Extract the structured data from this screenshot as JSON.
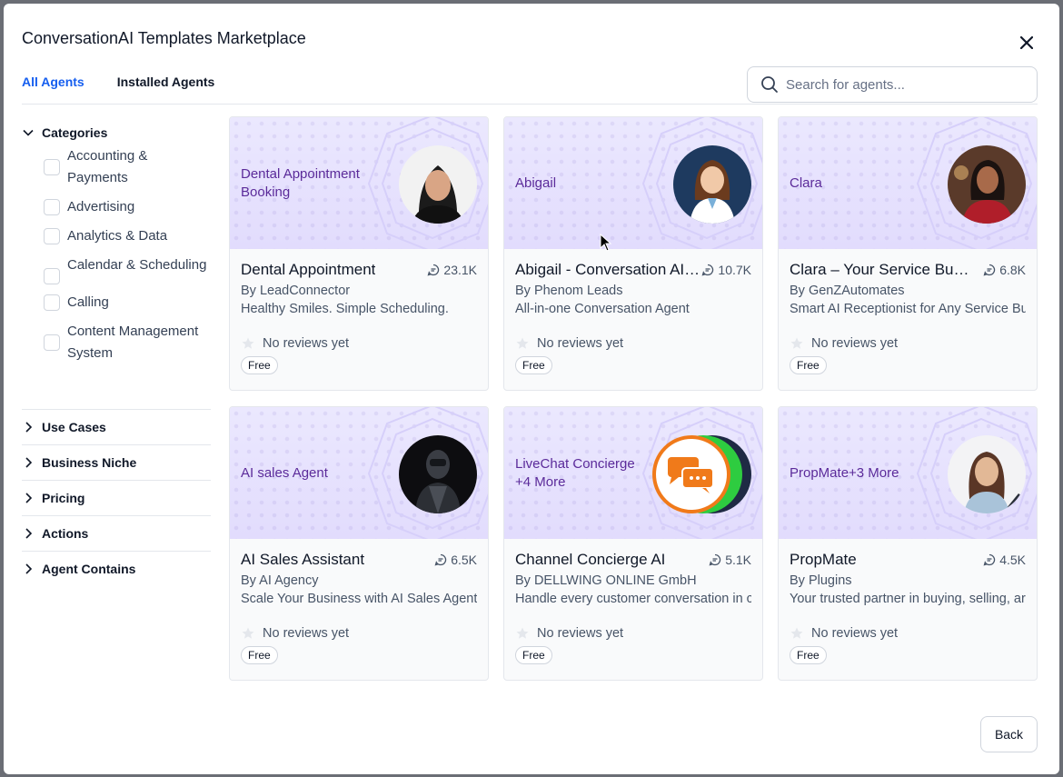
{
  "modal": {
    "title": "ConversationAI Templates Marketplace",
    "close_icon": "close-icon"
  },
  "tabs": [
    {
      "label": "All Agents",
      "active": true
    },
    {
      "label": "Installed Agents",
      "active": false
    }
  ],
  "search": {
    "placeholder": "Search for agents...",
    "value": ""
  },
  "sidebar": {
    "categories_label": "Categories",
    "categories": [
      "Accounting & Payments",
      "Advertising",
      "Analytics & Data",
      "Calendar & Scheduling",
      "Calling",
      "Content Management System"
    ],
    "sections": [
      "Use Cases",
      "Business Niche",
      "Pricing",
      "Actions",
      "Agent Contains"
    ]
  },
  "cards": [
    {
      "banner": "Dental Appointment Booking",
      "title": "Dental Appointment",
      "count": "23.1K",
      "by": "By LeadConnector",
      "desc": "Healthy Smiles. Simple Scheduling.",
      "reviews": "No reviews yet",
      "price": "Free",
      "avatar": "woman-portrait"
    },
    {
      "banner": "Abigail",
      "title": "Abigail - Conversation AI ...",
      "count": "10.7K",
      "by": "By Phenom Leads",
      "desc": "All-in-one Conversation Agent",
      "reviews": "No reviews yet",
      "price": "Free",
      "avatar": "cartoon-doctor"
    },
    {
      "banner": "Clara",
      "title": "Clara – Your Service Busin...",
      "count": "6.8K",
      "by": "By GenZAutomates",
      "desc": "Smart AI Receptionist for Any Service Bu",
      "reviews": "No reviews yet",
      "price": "Free",
      "avatar": "headset-woman"
    },
    {
      "banner": "AI sales Agent",
      "title": "AI Sales Assistant",
      "count": "6.5K",
      "by": "By AI Agency",
      "desc": "Scale Your Business with AI Sales Agent.",
      "reviews": "No reviews yet",
      "price": "Free",
      "avatar": "robot"
    },
    {
      "banner": "LiveChat Concierge +4 More",
      "title": "Channel Concierge AI",
      "count": "5.1K",
      "by": "By DELLWING ONLINE GmbH",
      "desc": "Handle every customer conversation in c",
      "reviews": "No reviews yet",
      "price": "Free",
      "avatar": "chat-bubbles"
    },
    {
      "banner": "PropMate+3 More",
      "title": "PropMate",
      "count": "4.5K",
      "by": "By Plugins",
      "desc": "Your trusted partner in buying, selling, ar",
      "reviews": "No reviews yet",
      "price": "Free",
      "avatar": "smiling-woman"
    }
  ],
  "footer": {
    "back_label": "Back"
  },
  "colors": {
    "accent": "#155eef",
    "banner_text": "#5b2b9a",
    "banner_bg": "#ebe8fe"
  }
}
